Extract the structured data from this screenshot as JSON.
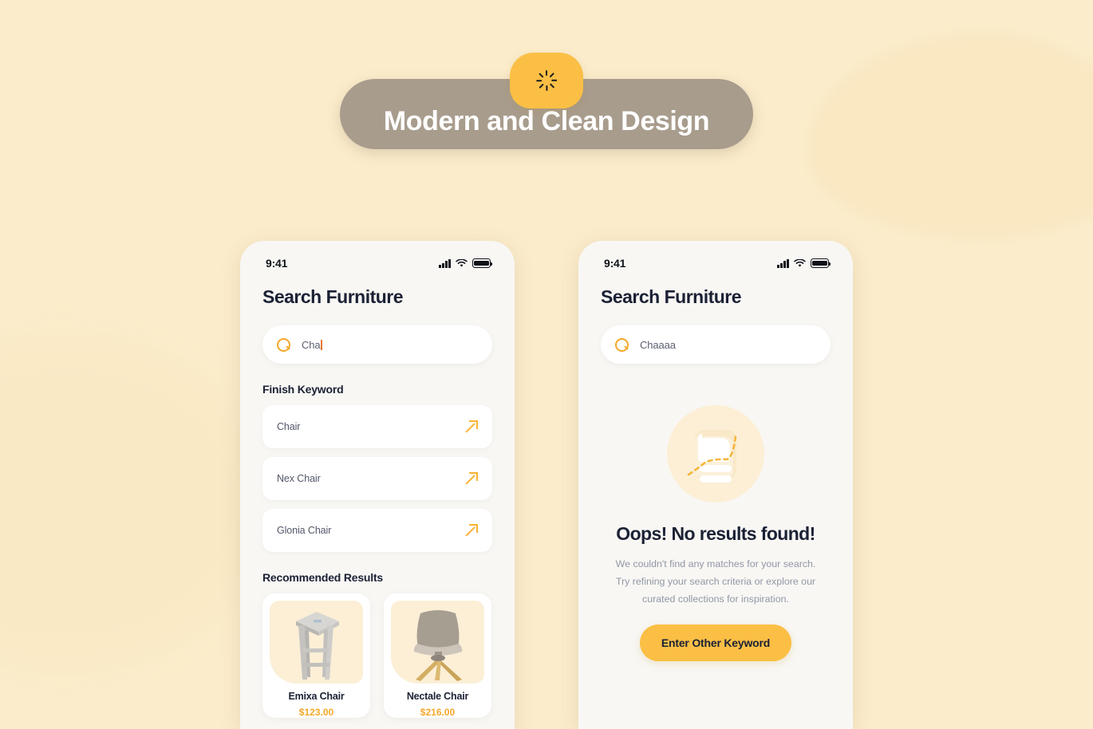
{
  "banner": {
    "title": "Modern and Clean Design",
    "badge_icon": "loading-spinner-icon",
    "pill_color": "#a89c8d",
    "badge_color": "#fbbf45"
  },
  "background": {
    "color": "#fbeccb",
    "blob_color": "#f9e7c0"
  },
  "phones": [
    {
      "status": {
        "time": "9:41",
        "signal_icon": "cellular-signal-icon",
        "wifi_icon": "wifi-icon",
        "battery_icon": "battery-full-icon"
      },
      "title": "Search Furniture",
      "search": {
        "icon": "search-icon",
        "value": "Cha",
        "placeholder": "Search",
        "caret_color": "#e8762c"
      },
      "keyword_section": {
        "heading": "Finish Keyword",
        "items": [
          {
            "label": "Chair",
            "icon": "arrow-up-right-icon"
          },
          {
            "label": "Nex Chair",
            "icon": "arrow-up-right-icon"
          },
          {
            "label": "Glonia Chair",
            "icon": "arrow-up-right-icon"
          }
        ]
      },
      "recommended": {
        "heading": "Recommended Results",
        "products": [
          {
            "name": "Emixa Chair",
            "price": "$123.00",
            "image": "bar-stool-image"
          },
          {
            "name": "Nectale Chair",
            "price": "$216.00",
            "image": "swivel-chair-image"
          }
        ]
      }
    },
    {
      "status": {
        "time": "9:41",
        "signal_icon": "cellular-signal-icon",
        "wifi_icon": "wifi-icon",
        "battery_icon": "battery-full-icon"
      },
      "title": "Search Furniture",
      "search": {
        "icon": "search-icon",
        "value": "Chaaaa",
        "placeholder": "Search"
      },
      "empty_state": {
        "illustration": "no-results-document-icon",
        "title": "Oops! No results found!",
        "body": "We couldn't find any matches for your search. Try refining your search criteria or explore our curated collections for inspiration.",
        "cta_label": "Enter Other Keyword",
        "cta_color": "#fbbf45"
      }
    }
  ]
}
